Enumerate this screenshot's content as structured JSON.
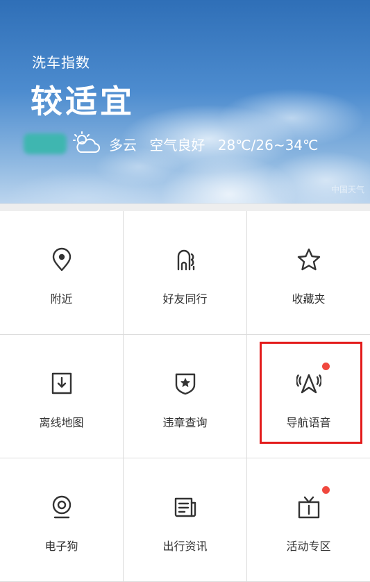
{
  "weather": {
    "wash_index_label": "洗车指数",
    "wash_index_level": "较适宜",
    "condition_icon": "partly-cloudy-icon",
    "condition": "多云",
    "air_quality": "空气良好",
    "temperature": "28℃/26~34℃",
    "watermark": "中国天气"
  },
  "grid": [
    {
      "label": "附近",
      "icon": "location-pin-icon",
      "badge": false
    },
    {
      "label": "好友同行",
      "icon": "friends-icon",
      "badge": false
    },
    {
      "label": "收藏夹",
      "icon": "star-icon",
      "badge": false
    },
    {
      "label": "离线地图",
      "icon": "download-map-icon",
      "badge": false
    },
    {
      "label": "违章查询",
      "icon": "shield-star-icon",
      "badge": false
    },
    {
      "label": "导航语音",
      "icon": "navigation-voice-icon",
      "badge": true
    },
    {
      "label": "电子狗",
      "icon": "camera-icon",
      "badge": false
    },
    {
      "label": "出行资讯",
      "icon": "news-icon",
      "badge": false
    },
    {
      "label": "活动专区",
      "icon": "gift-box-icon",
      "badge": true
    }
  ],
  "colors": {
    "badge": "#f0483e",
    "highlight": "#e31b1b",
    "label": "#333333"
  }
}
